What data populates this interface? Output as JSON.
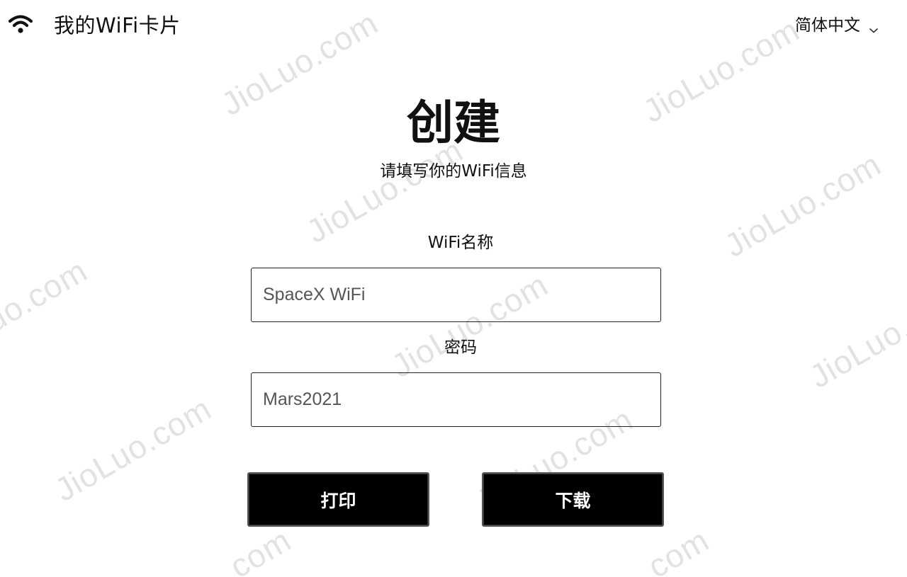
{
  "header": {
    "brand_icon": "wifi-icon",
    "brand_title": "我的WiFi卡片",
    "language": "简体中文",
    "language_icon": "chevron-down-icon"
  },
  "main": {
    "title": "创建",
    "subtitle": "请填写你的WiFi信息",
    "ssid_label": "WiFi名称",
    "ssid_value": "SpaceX WiFi",
    "password_label": "密码",
    "password_value": "Mars2021",
    "print_button": "打印",
    "download_button": "下载"
  },
  "watermark": {
    "text": "JioLuo.com",
    "partial_text": ".com"
  },
  "colors": {
    "background": "#ffffff",
    "text": "#111111",
    "button_bg": "#000000",
    "button_text": "#ffffff",
    "watermark": "#c8c8c8"
  }
}
